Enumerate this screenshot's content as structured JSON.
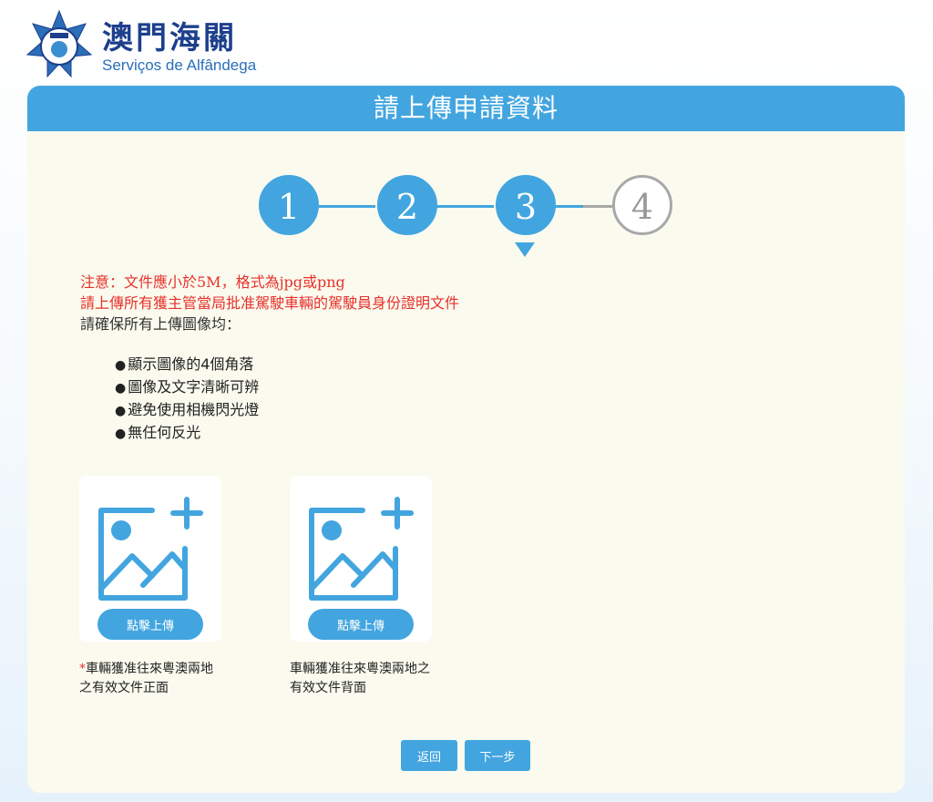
{
  "logo": {
    "name_cn": "澳門海關",
    "name_pt": "Serviços de Alfândega"
  },
  "panel": {
    "title": "請上傳申請資料"
  },
  "steps": {
    "items": [
      "1",
      "2",
      "3",
      "4"
    ],
    "current": 3
  },
  "notes": {
    "line1": "注意：文件應小於5M，格式為jpg或png",
    "line2": "請上傳所有獲主管當局批准駕駛車輛的駕駛員身份證明文件",
    "line3": "請確保所有上傳圖像均："
  },
  "bullets": [
    "顯示圖像的4個角落",
    "圖像及文字清晰可辨",
    "避免使用相機閃光燈",
    "無任何反光"
  ],
  "uploads": [
    {
      "button": "點擊上傳",
      "required_mark": "*",
      "label": "車輛獲准往來粵澳兩地之有效文件正面"
    },
    {
      "button": "點擊上傳",
      "required_mark": "",
      "label": "車輛獲准往來粵澳兩地之有效文件背面"
    }
  ],
  "actions": {
    "back": "返回",
    "next": "下一步"
  },
  "colors": {
    "accent": "#42a5df",
    "warning": "#e8302a",
    "panel_bg": "#fafaee",
    "brand": "#1d3f8c"
  }
}
